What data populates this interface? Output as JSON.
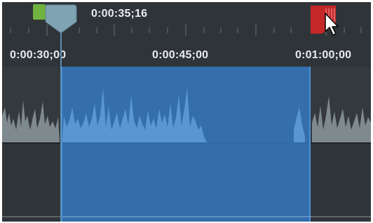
{
  "playhead": {
    "time": "0:00:35;16"
  },
  "ruler": {
    "labels": [
      "0:00:30;00",
      "0:00:45;00",
      "0:01:00;00"
    ]
  },
  "colors": {
    "background": "#2b3035",
    "selection": "#347ac4",
    "in_marker": "#6fb33e",
    "out_marker": "#c62828",
    "playhead": "#5a8fb3"
  },
  "icons": {
    "in_marker": "green-in-point-marker",
    "out_marker": "red-out-point-marker",
    "cursor": "mouse-pointer-icon"
  }
}
